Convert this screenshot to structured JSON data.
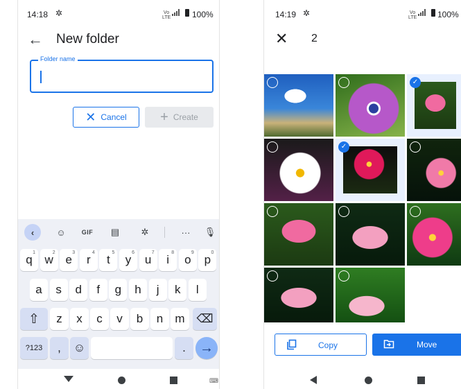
{
  "left_screen": {
    "status": {
      "time": "14:18",
      "network": "Vo LTE",
      "battery": "100%"
    },
    "title": "New folder",
    "field": {
      "label": "Folder name",
      "value": "",
      "placeholder": ""
    },
    "buttons": {
      "cancel": "Cancel",
      "create": "Create"
    },
    "keyboard": {
      "toolbar": {
        "gif": "GIF",
        "more": "···"
      },
      "row1": [
        {
          "key": "q",
          "hint": "1"
        },
        {
          "key": "w",
          "hint": "2"
        },
        {
          "key": "e",
          "hint": "3"
        },
        {
          "key": "r",
          "hint": "4"
        },
        {
          "key": "t",
          "hint": "5"
        },
        {
          "key": "y",
          "hint": "6"
        },
        {
          "key": "u",
          "hint": "7"
        },
        {
          "key": "i",
          "hint": "8"
        },
        {
          "key": "o",
          "hint": "9"
        },
        {
          "key": "p",
          "hint": "0"
        }
      ],
      "row2": [
        "a",
        "s",
        "d",
        "f",
        "g",
        "h",
        "j",
        "k",
        "l"
      ],
      "row3": [
        "z",
        "x",
        "c",
        "v",
        "b",
        "n",
        "m"
      ],
      "row4": {
        "symbols": "?123",
        "comma": ",",
        "period": "."
      }
    }
  },
  "right_screen": {
    "status": {
      "time": "14:19",
      "network": "Vo LTE",
      "battery": "100%"
    },
    "selected_count": "2",
    "photos": [
      {
        "subject": "partial-top",
        "selected": false
      },
      {
        "subject": "partial-top",
        "selected": false
      },
      {
        "subject": "partial-top",
        "selected": false
      },
      {
        "subject": "heart-cloud-sky",
        "selected": false
      },
      {
        "subject": "purple-daisy",
        "selected": false
      },
      {
        "subject": "pink-lotus",
        "selected": true
      },
      {
        "subject": "white-daisy",
        "selected": false
      },
      {
        "subject": "pink-cosmos",
        "selected": true
      },
      {
        "subject": "pink-cosmos-dark",
        "selected": false
      },
      {
        "subject": "pink-lotus",
        "selected": false
      },
      {
        "subject": "pink-lotus-dark",
        "selected": false
      },
      {
        "subject": "pink-cosmos-bright",
        "selected": false
      },
      {
        "subject": "pink-lotus-dark",
        "selected": false
      },
      {
        "subject": "pink-lotus-green",
        "selected": false
      }
    ],
    "buttons": {
      "copy": "Copy",
      "move": "Move"
    }
  },
  "colors": {
    "accent": "#1a73e8",
    "keyboard_bg": "#eef0f6",
    "selected_tint": "#e8f0fe"
  }
}
